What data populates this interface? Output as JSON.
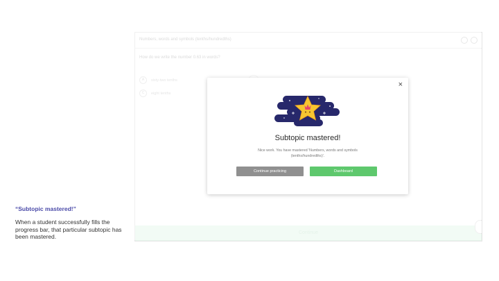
{
  "caption": {
    "title": "“Subtopic mastered!”",
    "body": "When a student successfully fills the progress bar, that particular subtopic has been mastered."
  },
  "app": {
    "header_title": "Numbers, words and symbols (tenths/hundredths)",
    "question": "How do we write the number 0.63 in words?",
    "options": [
      {
        "letter": "A",
        "text": "sixty-two tenths"
      },
      {
        "letter": "C",
        "text": "eight tenths"
      }
    ],
    "continue_label": "Continue"
  },
  "modal": {
    "close_glyph": "×",
    "title": "Subtopic mastered!",
    "message": "Nice work. You have mastered 'Numbers, words and symbols (tenths/hundredths)'.",
    "continue_button": "Continue practicing",
    "dashboard_button": "Dashboard"
  },
  "colors": {
    "accent_green": "#5ec86d",
    "secondary_grey": "#909090",
    "caption_title": "#4a4aa8",
    "illustration_navy": "#27286b",
    "star_yellow": "#f7c631"
  }
}
